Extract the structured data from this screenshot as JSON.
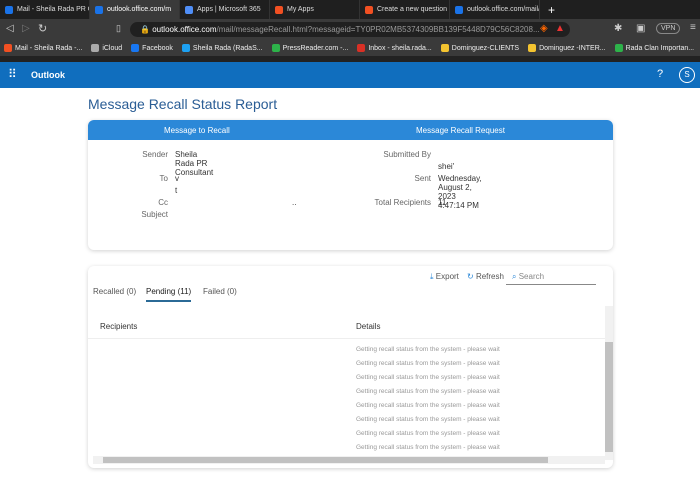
{
  "browser": {
    "tabs": [
      {
        "label": "Mail - Sheila Rada PR Co",
        "color": "#1a73e8"
      },
      {
        "label": "outlook.office.com/m",
        "color": "#1a73e8",
        "active": true
      },
      {
        "label": "Apps | Microsoft 365",
        "color": "#4f8ef7"
      },
      {
        "label": "My Apps",
        "color": "#f25022"
      },
      {
        "label": "Create a new question o",
        "color": "#f25022"
      },
      {
        "label": "outlook.office.com/mail/",
        "color": "#1a73e8"
      }
    ],
    "url_host": "outlook.office.com",
    "url_path": "/mail/messageRecall.html?messageid=TY0PR02MB5374309BB139F5448D79C56C8208...",
    "vpn": "VPN",
    "bookmarks": [
      "Mail - Sheila Rada -...",
      "iCloud",
      "Facebook",
      "Sheila Rada (RadaS...",
      "PressReader.com -...",
      "Inbox - sheila.rada...",
      "Dominguez-CLIENTS",
      "Dominguez -INTER...",
      "Rada Clan Importan..."
    ]
  },
  "app": {
    "name": "Outlook",
    "help": "?",
    "avatar": "S",
    "accent": "#106ebe"
  },
  "page": {
    "title": "Message Recall Status Report"
  },
  "summary": {
    "left_header": "Message to Recall",
    "right_header": "Message Recall Request",
    "sender_label": "Sender",
    "sender": "Sheila Rada PR Consultant",
    "to_label": "To",
    "to_lines": [
      "v",
      "t"
    ],
    "cc_label": "Cc",
    "cc": "..",
    "subject_label": "Subject",
    "submitted_label": "Submitted By",
    "submitted": "shei'",
    "sent_label": "Sent",
    "sent": "Wednesday, August 2, 2023 4:47:14 PM",
    "total_label": "Total Recipients",
    "total": "11"
  },
  "status": {
    "export": "Export",
    "refresh": "Refresh",
    "search_placeholder": "Search",
    "tabs": [
      "Recalled (0)",
      "Pending (11)",
      "Failed (0)"
    ],
    "active_tab": 1,
    "columns": [
      "Recipients",
      "Details"
    ],
    "rows": [
      "Getting recall status from the system - please wait",
      "Getting recall status from the system - please wait",
      "Getting recall status from the system - please wait",
      "Getting recall status from the system - please wait",
      "Getting recall status from the system - please wait",
      "Getting recall status from the system - please wait",
      "Getting recall status from the system - please wait",
      "Getting recall status from the system - please wait"
    ]
  }
}
